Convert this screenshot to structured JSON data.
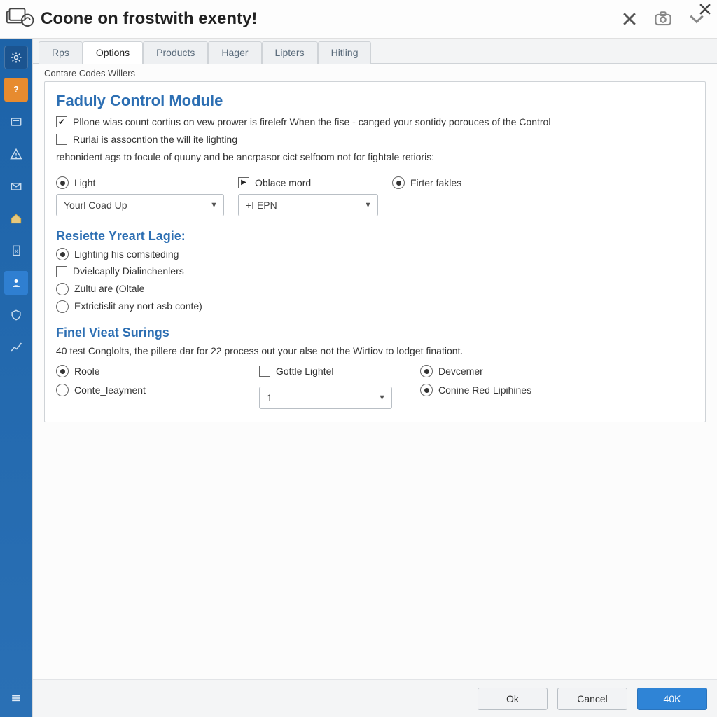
{
  "window": {
    "title": "Coone on frostwith exenty!"
  },
  "tabs": [
    {
      "label": "Rps"
    },
    {
      "label": "Options",
      "active": true
    },
    {
      "label": "Products"
    },
    {
      "label": "Hager"
    },
    {
      "label": "Lipters"
    },
    {
      "label": "Hitling"
    }
  ],
  "group": {
    "legend": "Contare Codes Willers",
    "title": "Faduly Control Module",
    "check_1": {
      "label": "Pllone wias count cortius on vew prower is firelefr When the fise - canged your sontidy porouces of the Control"
    },
    "check_2": {
      "label": "Rurlai is assocntion the will ite lighting"
    },
    "paragraph": "rehonident ags to focule of quuny and be ancrpasor cict selfoom not for fightale retioris:",
    "row1": {
      "opt_light": "Light",
      "opt_oblace": "Oblace mord",
      "opt_filter": "Firter fakles",
      "dd1": "Yourl Coad Up",
      "dd2": "+I EPN"
    },
    "section2_title": "Resiette Yreart Lagie:",
    "s2_opts": {
      "a": "Lighting his comsiteding",
      "b": "Dvielcaplly Dialinchenlers",
      "c": "Zultu are (Oltale",
      "d": "Extrictislit any nort asb conte)"
    },
    "section3_title": "Finel Vieat Surings",
    "s3_desc": "40 test Conglolts, the pillere dar for 22 process out your alse not the Wirtiov to lodget finationt.",
    "s3": {
      "roole": "Roole",
      "conte": "Conte_leayment",
      "gottle": "Gottle Lightel",
      "dd_val": "1",
      "dev": "Devcemer",
      "conine": "Conine Red Lipihines"
    }
  },
  "footer": {
    "ok": "Ok",
    "cancel": "Cancel",
    "apply": "40K"
  }
}
